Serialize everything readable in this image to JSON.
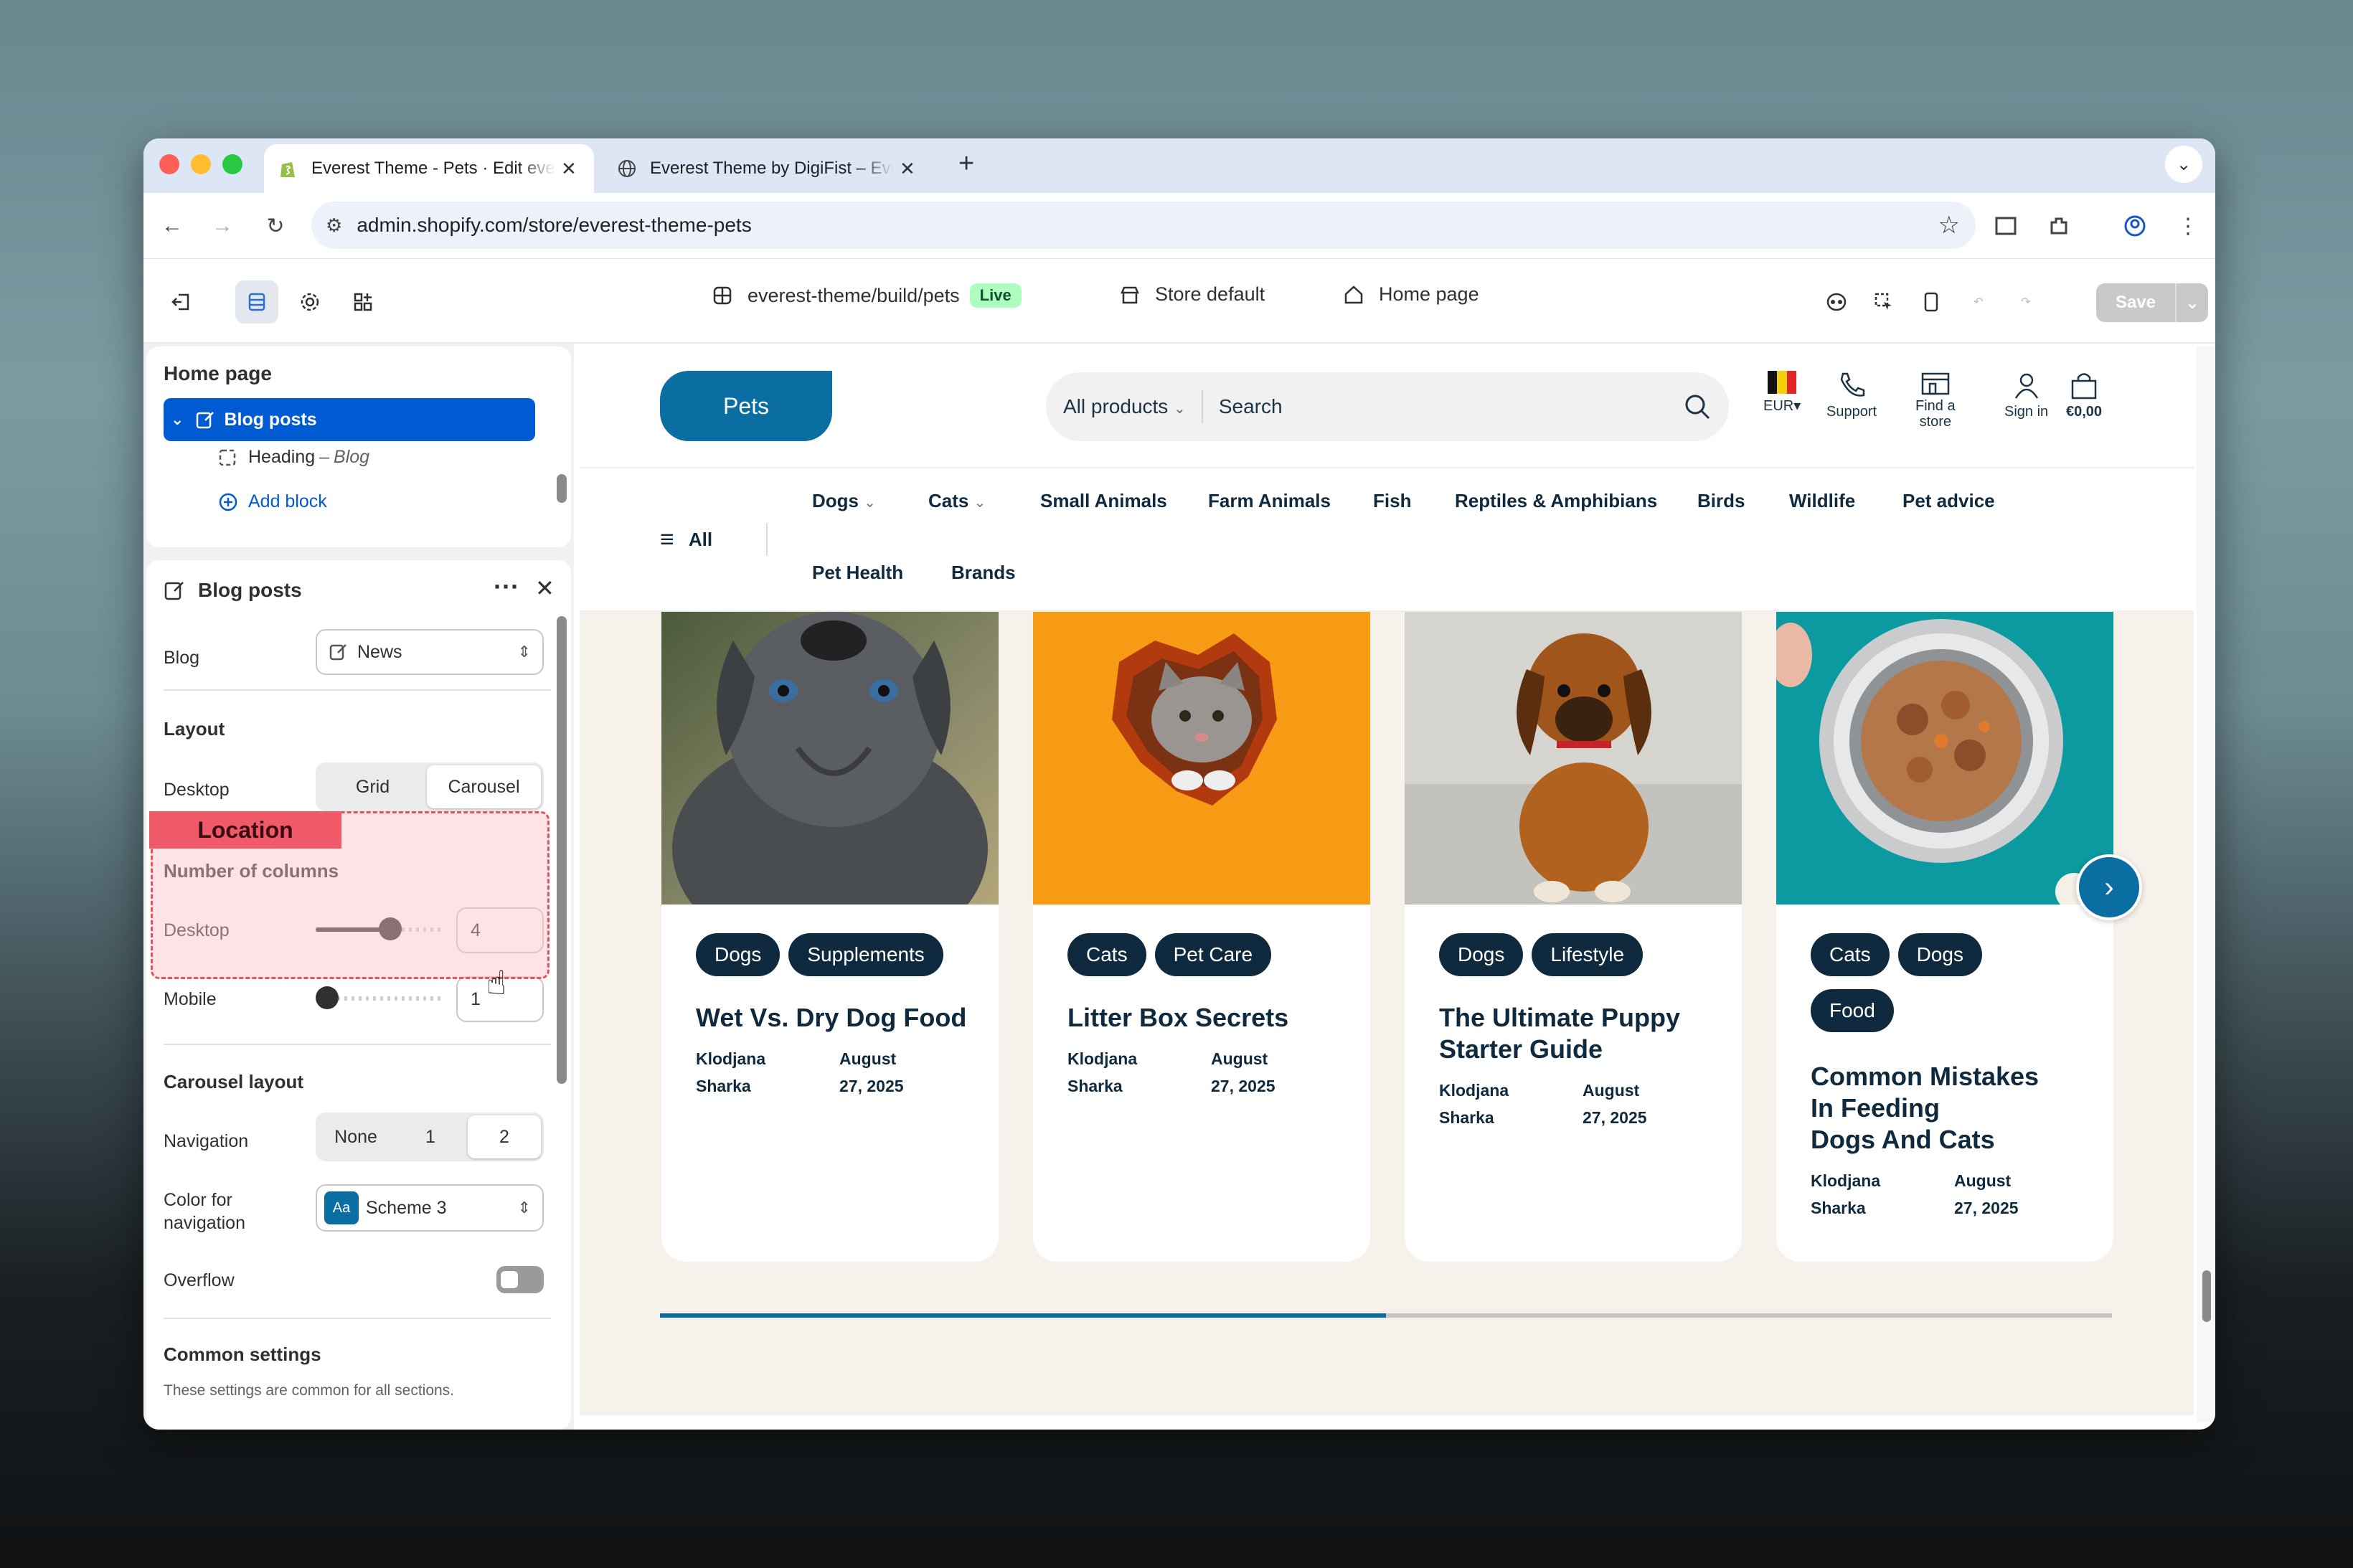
{
  "browser": {
    "tabs": [
      {
        "title": "Everest Theme - Pets · Edit everest",
        "active": true
      },
      {
        "title": "Everest Theme by DigiFist – Everest",
        "active": false
      }
    ],
    "url": "admin.shopify.com/store/everest-theme-pets"
  },
  "toolbar": {
    "theme_path": "everest-theme/build/pets",
    "live_badge": "Live",
    "store_default": "Store default",
    "page": "Home page",
    "save_label": "Save"
  },
  "sidebar": {
    "page_title": "Home page",
    "section_label": "Blog posts",
    "heading_block": "Heading",
    "heading_block_sub": "Blog",
    "add_block": "Add block",
    "panel_title": "Blog posts",
    "blog_label": "Blog",
    "blog_value": "News",
    "location_tag": "Location",
    "layout_header": "Layout",
    "desktop_label": "Desktop",
    "layout_options": [
      "Grid",
      "Carousel"
    ],
    "layout_selected": "Carousel",
    "columns_header": "Number of columns",
    "desktop_cols_label": "Desktop",
    "desktop_cols_value": "4",
    "mobile_cols_label": "Mobile",
    "mobile_cols_value": "1",
    "carousel_header": "Carousel layout",
    "navigation_label": "Navigation",
    "navigation_options": [
      "None",
      "1",
      "2"
    ],
    "navigation_selected": "2",
    "color_nav_label_1": "Color for",
    "color_nav_label_2": "navigation",
    "color_nav_swatch": "Aa",
    "color_nav_value": "Scheme 3",
    "overflow_label": "Overflow",
    "overflow_on": false,
    "common_header": "Common settings",
    "common_desc": "These settings are common for all sections."
  },
  "store": {
    "logo": "Pets",
    "search_category": "All products",
    "search_placeholder": "Search",
    "currency": "EUR",
    "support": "Support",
    "find_store_1": "Find a",
    "find_store_2": "store",
    "sign_in": "Sign in",
    "cart": "€0,00",
    "all_menu": "All",
    "menu_items": [
      "Dogs",
      "Cats",
      "Small Animals",
      "Farm Animals",
      "Fish",
      "Reptiles & Amphibians",
      "Birds",
      "Wildlife",
      "Pet advice",
      "Pet Health",
      "Brands"
    ],
    "cards": [
      {
        "tags": [
          "Dogs",
          "Supplements"
        ],
        "title": "Wet Vs. Dry Dog Food",
        "author_1": "Klodjana",
        "author_2": "Sharka",
        "date_1": "August",
        "date_2": "27, 2025"
      },
      {
        "tags": [
          "Cats",
          "Pet Care"
        ],
        "title": "Litter Box Secrets",
        "author_1": "Klodjana",
        "author_2": "Sharka",
        "date_1": "August",
        "date_2": "27, 2025"
      },
      {
        "tags": [
          "Dogs",
          "Lifestyle"
        ],
        "title_1": "The Ultimate Puppy",
        "title_2": "Starter Guide",
        "author_1": "Klodjana",
        "author_2": "Sharka",
        "date_1": "August",
        "date_2": "27, 2025"
      },
      {
        "tags": [
          "Cats",
          "Dogs",
          "Food"
        ],
        "title_1": "Common Mistakes",
        "title_2": "In Feeding",
        "title_3": "Dogs And Cats",
        "author_1": "Klodjana",
        "author_2": "Sharka",
        "date_1": "August",
        "date_2": "27, 2025"
      }
    ],
    "carousel_progress": 0.5
  },
  "colors": {
    "shopify_blue": "#005bd3",
    "store_blue": "#0a6ea3",
    "navy": "#0f2a3f",
    "location_red": "#f05a68"
  }
}
